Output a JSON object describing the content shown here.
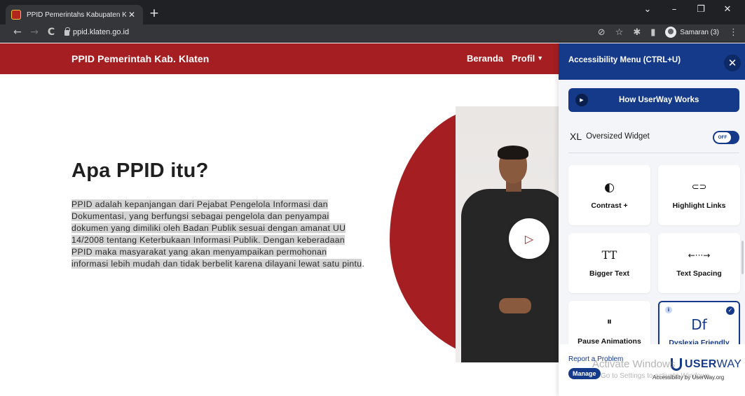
{
  "browser": {
    "tab_title": "PPID Pemerintahs Kabupaten Kla",
    "tab_close": "✕",
    "new_tab": "+",
    "url": "ppid.klaten.go.id",
    "profile_name": "Samaran (3)",
    "window_controls": {
      "collapse": "⌄",
      "minimize": "–",
      "restore": "❐",
      "close": "✕"
    },
    "nav": {
      "back": "←",
      "forward": "→",
      "reload": "C"
    },
    "toolbar_icons": {
      "privacy": "⊘",
      "bookmark": "☆",
      "extensions": "✱",
      "sidepanel": "▮",
      "menu": "⋮"
    }
  },
  "site": {
    "title": "PPID Pemerintah Kab. Klaten",
    "nav": [
      {
        "label": "Beranda"
      },
      {
        "label": "Profil",
        "has_dropdown": true
      }
    ],
    "hero": {
      "heading": "Apa PPID itu?",
      "paragraph_highlighted": "PPID adalah kepanjangan dari Pejabat Pengelola Informasi dan Dokumentasi, yang berfungsi sebagai pengelola dan penyampai dokumen yang dimiliki oleh Badan Publik sesuai dengan amanat UU 14/2008 tentang Keterbukaan Informasi Publik. Dengan keberadaan PPID maka masyarakat yang akan menyampaikan permohonan informasi lebih mudah dan tidak berbelit karena dilayani lewat satu pintu",
      "paragraph_end": "."
    },
    "video": {
      "play_icon": "▷"
    },
    "colors": {
      "brand_red": "#a51f22"
    }
  },
  "userway": {
    "header_title": "Accessibility Menu (CTRL+U)",
    "close_label": "✕",
    "how_it_works": "How UserWay Works",
    "oversized": {
      "xl": "XL",
      "label": "Oversized Widget",
      "toggle_state": "OFF"
    },
    "cards": [
      {
        "label": "Contrast +",
        "icon": "◐"
      },
      {
        "label": "Highlight Links",
        "icon": "⊂⊃"
      },
      {
        "label": "Bigger Text",
        "icon": "TT"
      },
      {
        "label": "Text Spacing",
        "icon": "←···→"
      },
      {
        "label": "Pause Animations",
        "icon": "⏸"
      },
      {
        "label": "Dyslexia Friendly",
        "icon": "Df",
        "active": true
      }
    ],
    "footer": {
      "report": "Report a Problem",
      "manage": "Manage",
      "logo_prefix": "USER",
      "logo_suffix": "WAY",
      "logo_sub": "Accessibility by UserWay.org"
    },
    "colors": {
      "accent": "#153a8a"
    }
  },
  "os_watermark": {
    "title": "Activate Windows",
    "subtitle": "Go to Settings to activate Windows."
  }
}
